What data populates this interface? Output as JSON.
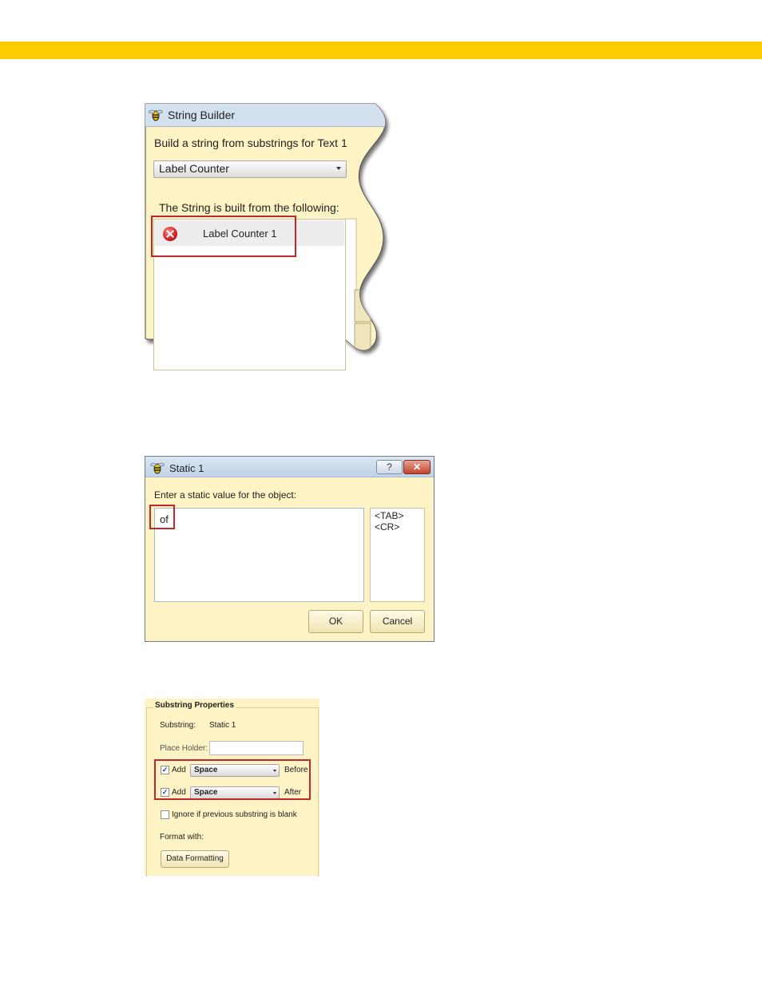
{
  "brand": {
    "accent_color": "#ffcc00",
    "highlight_color": "#c1272d"
  },
  "string_builder": {
    "title": "String Builder",
    "icon": "app-wasp-icon",
    "prompt": "Build a string from substrings for Text 1",
    "selected_option": "Label Counter",
    "list_label": "The String is built from the following:",
    "list_items": [
      {
        "label": "Label Counter 1",
        "icon": "error-icon"
      }
    ]
  },
  "static_dialog": {
    "title": "Static 1",
    "help_label": "?",
    "close_label": "✕",
    "prompt": "Enter a static value for the object:",
    "value": "of",
    "special_chars": [
      "<TAB>",
      "<CR>"
    ],
    "ok_label": "OK",
    "cancel_label": "Cancel"
  },
  "substring_properties": {
    "title": "Substring Properties",
    "substring_label": "Substring:",
    "substring_value": "Static 1",
    "placeholder_label": "Place Holder:",
    "add_before": {
      "checked": true,
      "label": "Add",
      "option": "Space",
      "suffix": "Before"
    },
    "add_after": {
      "checked": true,
      "label": "Add",
      "option": "Space",
      "suffix": "After"
    },
    "ignore_label": "Ignore if previous substring is blank",
    "ignore_checked": false,
    "format_label": "Format with:",
    "format_button": "Data Formatting"
  }
}
